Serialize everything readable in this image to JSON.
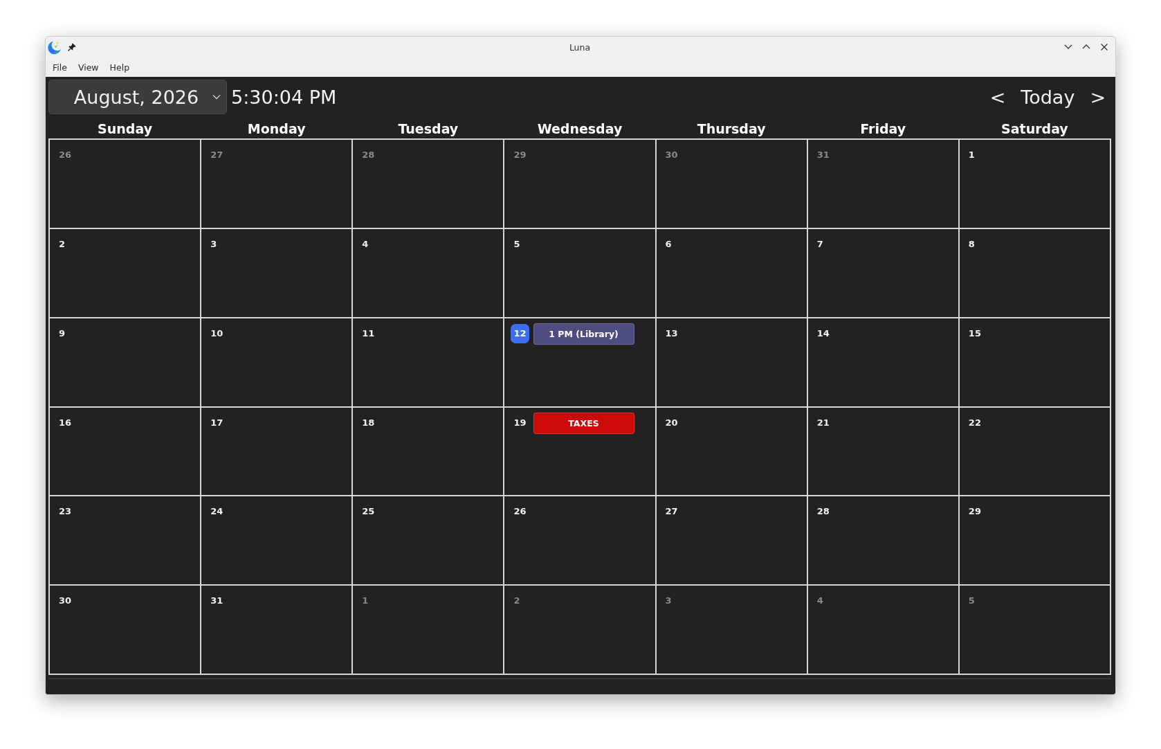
{
  "window": {
    "title": "Luna"
  },
  "menu": [
    {
      "label": "File"
    },
    {
      "label": "View"
    },
    {
      "label": "Help"
    }
  ],
  "toolbar": {
    "month_picker": "August, 2026",
    "clock": "5:30:04 PM",
    "prev": "<",
    "today": "Today",
    "next": ">"
  },
  "weekdays": [
    "Sunday",
    "Monday",
    "Tuesday",
    "Wednesday",
    "Thursday",
    "Friday",
    "Saturday"
  ],
  "weeks": [
    [
      {
        "day": "26",
        "in_month": false,
        "today": false
      },
      {
        "day": "27",
        "in_month": false,
        "today": false
      },
      {
        "day": "28",
        "in_month": false,
        "today": false
      },
      {
        "day": "29",
        "in_month": false,
        "today": false
      },
      {
        "day": "30",
        "in_month": false,
        "today": false
      },
      {
        "day": "31",
        "in_month": false,
        "today": false
      },
      {
        "day": "1",
        "in_month": true,
        "today": false
      }
    ],
    [
      {
        "day": "2",
        "in_month": true,
        "today": false
      },
      {
        "day": "3",
        "in_month": true,
        "today": false
      },
      {
        "day": "4",
        "in_month": true,
        "today": false
      },
      {
        "day": "5",
        "in_month": true,
        "today": false
      },
      {
        "day": "6",
        "in_month": true,
        "today": false
      },
      {
        "day": "7",
        "in_month": true,
        "today": false
      },
      {
        "day": "8",
        "in_month": true,
        "today": false
      }
    ],
    [
      {
        "day": "9",
        "in_month": true,
        "today": false
      },
      {
        "day": "10",
        "in_month": true,
        "today": false
      },
      {
        "day": "11",
        "in_month": true,
        "today": false
      },
      {
        "day": "12",
        "in_month": true,
        "today": true,
        "events": [
          {
            "label": "1 PM (Library)",
            "color": "#4e4d7f"
          }
        ]
      },
      {
        "day": "13",
        "in_month": true,
        "today": false
      },
      {
        "day": "14",
        "in_month": true,
        "today": false
      },
      {
        "day": "15",
        "in_month": true,
        "today": false
      }
    ],
    [
      {
        "day": "16",
        "in_month": true,
        "today": false
      },
      {
        "day": "17",
        "in_month": true,
        "today": false
      },
      {
        "day": "18",
        "in_month": true,
        "today": false
      },
      {
        "day": "19",
        "in_month": true,
        "today": false,
        "events": [
          {
            "label": "TAXES",
            "color": "#cc0a0a"
          }
        ]
      },
      {
        "day": "20",
        "in_month": true,
        "today": false
      },
      {
        "day": "21",
        "in_month": true,
        "today": false
      },
      {
        "day": "22",
        "in_month": true,
        "today": false
      }
    ],
    [
      {
        "day": "23",
        "in_month": true,
        "today": false
      },
      {
        "day": "24",
        "in_month": true,
        "today": false
      },
      {
        "day": "25",
        "in_month": true,
        "today": false
      },
      {
        "day": "26",
        "in_month": true,
        "today": false
      },
      {
        "day": "27",
        "in_month": true,
        "today": false
      },
      {
        "day": "28",
        "in_month": true,
        "today": false
      },
      {
        "day": "29",
        "in_month": true,
        "today": false
      }
    ],
    [
      {
        "day": "30",
        "in_month": true,
        "today": false
      },
      {
        "day": "31",
        "in_month": true,
        "today": false
      },
      {
        "day": "1",
        "in_month": false,
        "today": false
      },
      {
        "day": "2",
        "in_month": false,
        "today": false
      },
      {
        "day": "3",
        "in_month": false,
        "today": false
      },
      {
        "day": "4",
        "in_month": false,
        "today": false
      },
      {
        "day": "5",
        "in_month": false,
        "today": false
      }
    ]
  ]
}
